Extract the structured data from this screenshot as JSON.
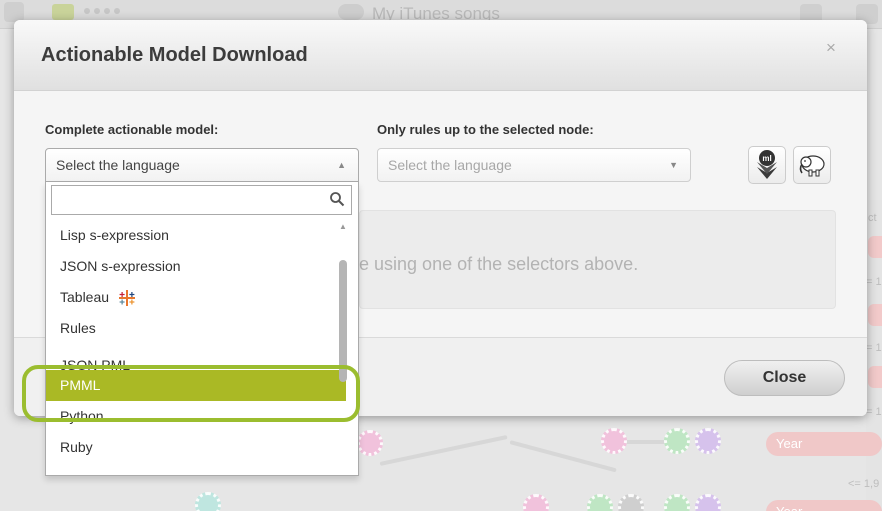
{
  "background": {
    "app_title": "My iTunes songs",
    "pills": [
      "Year",
      "Year"
    ],
    "conditions": [
      "<= 1,9",
      "ct",
      "= 1",
      "= 1",
      "= 1"
    ]
  },
  "modal": {
    "title": "Actionable Model Download",
    "close_symbol": "×",
    "complete_label": "Complete actionable model:",
    "rules_label": "Only rules up to the selected node:",
    "complete_select_value": "Select the language",
    "rules_select_value": "Select the language",
    "info_text": "ge using one of the selectors above.",
    "close_button": "Close"
  },
  "dropdown": {
    "search_value": "",
    "options": [
      {
        "label": "Lisp s-expression",
        "icon": ""
      },
      {
        "label": "JSON s-expression",
        "icon": ""
      },
      {
        "label": "Tableau",
        "icon": "tableau-icon"
      },
      {
        "label": "Rules",
        "icon": ""
      },
      {
        "label": "JSON PML",
        "icon": ""
      },
      {
        "label": "PMML",
        "icon": "",
        "selected": true
      },
      {
        "label": "Python",
        "icon": ""
      },
      {
        "label": "Ruby",
        "icon": ""
      }
    ]
  },
  "colors": {
    "accent": "#aab925",
    "highlight_ring": "#9bbd2f",
    "pill": "#f0c8c8"
  },
  "icons": [
    "search-icon",
    "bigml-download-icon",
    "hadoop-elephant-icon",
    "tableau-icon",
    "chevron-up-icon",
    "chevron-down-icon",
    "close-icon"
  ]
}
